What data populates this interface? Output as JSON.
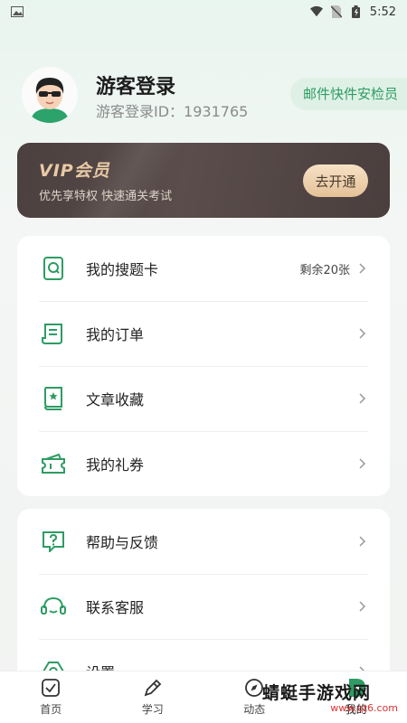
{
  "status_bar": {
    "time": "5:52"
  },
  "profile": {
    "name": "游客登录",
    "uid": "游客登录ID：1931765",
    "badge": "邮件快件安检员"
  },
  "vip": {
    "title": "VIP会员",
    "subtitle": "优先享特权 快速通关考试",
    "button": "去开通"
  },
  "menu1": [
    {
      "label": "我的搜题卡",
      "extra": "剩余20张",
      "icon": "search-card-icon"
    },
    {
      "label": "我的订单",
      "icon": "order-icon"
    },
    {
      "label": "文章收藏",
      "icon": "favorite-book-icon"
    },
    {
      "label": "我的礼券",
      "icon": "coupon-icon"
    }
  ],
  "menu2": [
    {
      "label": "帮助与反馈",
      "icon": "help-icon"
    },
    {
      "label": "联系客服",
      "icon": "headset-icon"
    },
    {
      "label": "设置",
      "icon": "settings-icon"
    }
  ],
  "tabs": [
    {
      "label": "首页",
      "icon": "home-check-icon"
    },
    {
      "label": "学习",
      "icon": "pencil-icon"
    },
    {
      "label": "动态",
      "icon": "compass-icon"
    },
    {
      "label": "我的",
      "icon": "profile-icon"
    }
  ],
  "watermark": {
    "text": "蜻蜓手游戏网",
    "url": "www.qt6.com"
  },
  "colors": {
    "accent": "#2e9c63",
    "vip_bg": "#4b3f3f",
    "vip_gold": "#e8caa5"
  }
}
